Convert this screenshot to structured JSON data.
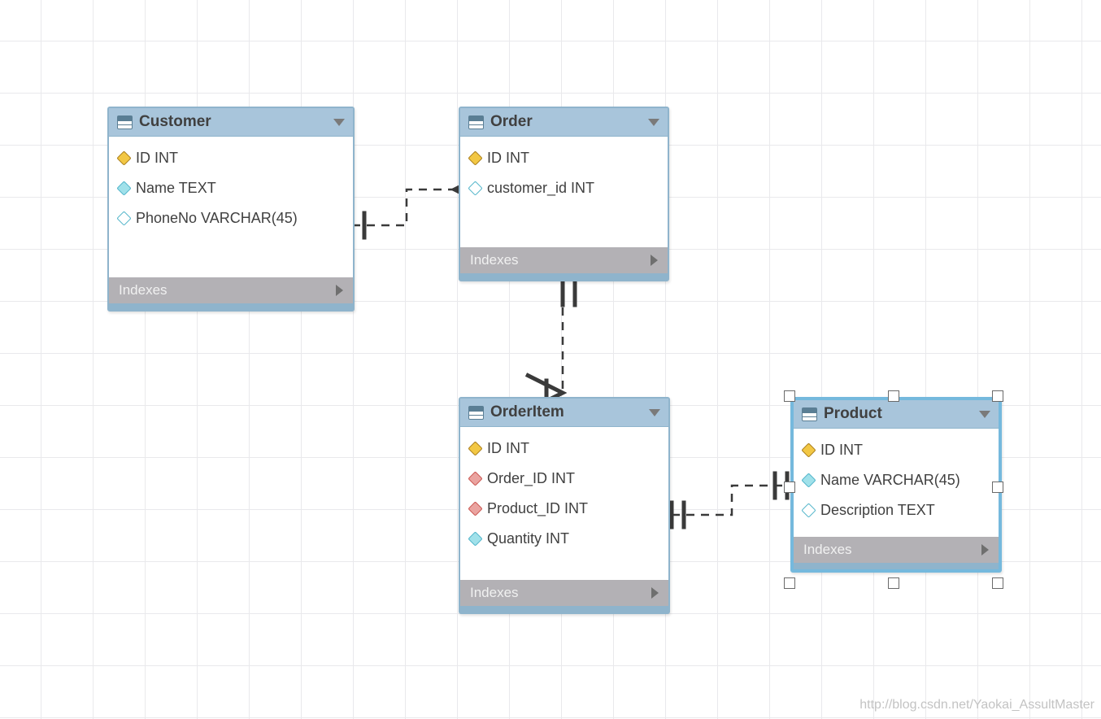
{
  "tables": {
    "customer": {
      "title": "Customer",
      "columns": [
        {
          "icon": "key",
          "label": "ID INT"
        },
        {
          "icon": "dia",
          "label": "Name TEXT"
        },
        {
          "icon": "dia-open",
          "label": "PhoneNo VARCHAR(45)"
        }
      ],
      "footer": "Indexes"
    },
    "order": {
      "title": "Order",
      "columns": [
        {
          "icon": "key",
          "label": "ID INT"
        },
        {
          "icon": "dia-open",
          "label": "customer_id INT"
        }
      ],
      "footer": "Indexes"
    },
    "orderitem": {
      "title": "OrderItem",
      "columns": [
        {
          "icon": "key",
          "label": "ID INT"
        },
        {
          "icon": "dia-red",
          "label": "Order_ID INT"
        },
        {
          "icon": "dia-red",
          "label": "Product_ID INT"
        },
        {
          "icon": "dia",
          "label": "Quantity INT"
        }
      ],
      "footer": "Indexes"
    },
    "product": {
      "title": "Product",
      "columns": [
        {
          "icon": "key",
          "label": "ID INT"
        },
        {
          "icon": "dia",
          "label": "Name VARCHAR(45)"
        },
        {
          "icon": "dia-open",
          "label": "Description TEXT"
        }
      ],
      "footer": "Indexes"
    }
  },
  "watermark": "http://blog.csdn.net/Yaokai_AssultMaster"
}
